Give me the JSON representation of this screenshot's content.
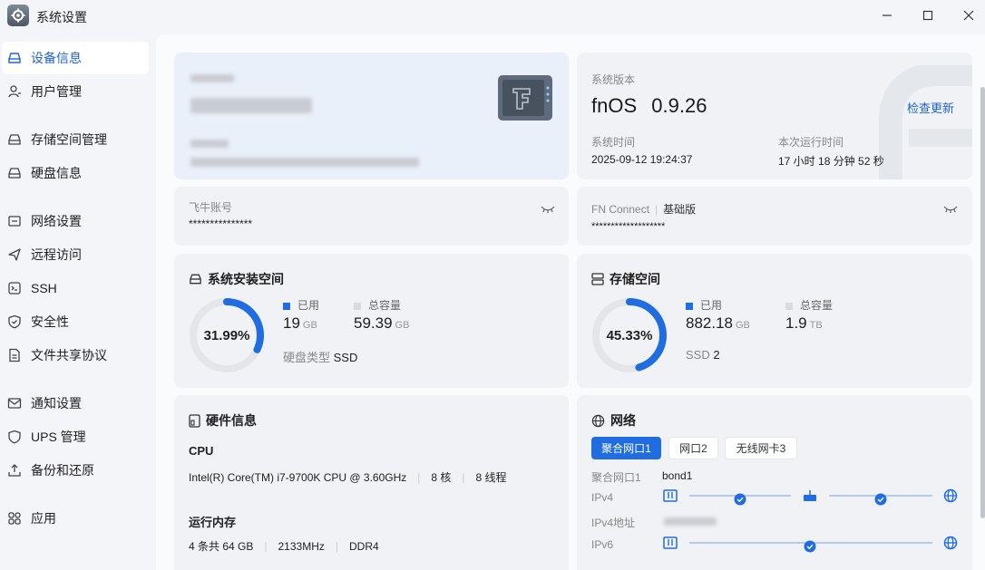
{
  "window": {
    "title": "系统设置"
  },
  "sidebar": {
    "items": [
      {
        "label": "设备信息"
      },
      {
        "label": "用户管理"
      },
      {
        "label": "存储空间管理"
      },
      {
        "label": "硬盘信息"
      },
      {
        "label": "网络设置"
      },
      {
        "label": "远程访问"
      },
      {
        "label": "SSH"
      },
      {
        "label": "安全性"
      },
      {
        "label": "文件共享协议"
      },
      {
        "label": "通知设置"
      },
      {
        "label": "UPS 管理"
      },
      {
        "label": "备份和还原"
      },
      {
        "label": "应用"
      }
    ]
  },
  "system": {
    "version_label": "系统版本",
    "os_name": "fnOS",
    "os_version": "0.9.26",
    "check_update": "检查更新",
    "time_label": "系统时间",
    "time_value": "2025-09-12 19:24:37",
    "uptime_label": "本次运行时间",
    "uptime_value": "17 小时 18 分钟 52 秒"
  },
  "account": {
    "label": "飞牛账号",
    "value": "***************"
  },
  "fnconnect": {
    "label": "FN Connect",
    "edition": "基础版",
    "value": "*******************"
  },
  "system_space": {
    "title": "系统安装空间",
    "percent": "31.99%",
    "percent_value": 0.3199,
    "used_label": "已用",
    "used_value": "19",
    "used_unit": "GB",
    "total_label": "总容量",
    "total_value": "59.39",
    "total_unit": "GB",
    "disk_type_label": "硬盘类型",
    "disk_type_value": "SSD"
  },
  "storage_space": {
    "title": "存储空间",
    "percent": "45.33%",
    "percent_value": 0.4533,
    "used_label": "已用",
    "used_value": "882.18",
    "used_unit": "GB",
    "total_label": "总容量",
    "total_value": "1.9",
    "total_unit": "TB",
    "ssd_label": "SSD",
    "ssd_count": "2"
  },
  "hardware": {
    "title": "硬件信息",
    "cpu_label": "CPU",
    "cpu_model": "Intel(R) Core(TM) i7-9700K CPU @ 3.60GHz",
    "cpu_cores": "8 核",
    "cpu_threads": "8 线程",
    "mem_label": "运行内存",
    "mem_total": "4 条共 64 GB",
    "mem_speed": "2133MHz",
    "mem_type": "DDR4"
  },
  "network": {
    "title": "网络",
    "tabs": [
      {
        "label": "聚合网口1"
      },
      {
        "label": "网口2"
      },
      {
        "label": "无线网卡3"
      }
    ],
    "iface_label": "聚合网口1",
    "iface_value": "bond1",
    "ipv4_label": "IPv4",
    "ipv4addr_label": "IPv4地址",
    "ipv6_label": "IPv6"
  },
  "colors": {
    "accent": "#1f6de0",
    "ring_track": "#e3e5e9",
    "legend_total": "#d9dbdf"
  }
}
